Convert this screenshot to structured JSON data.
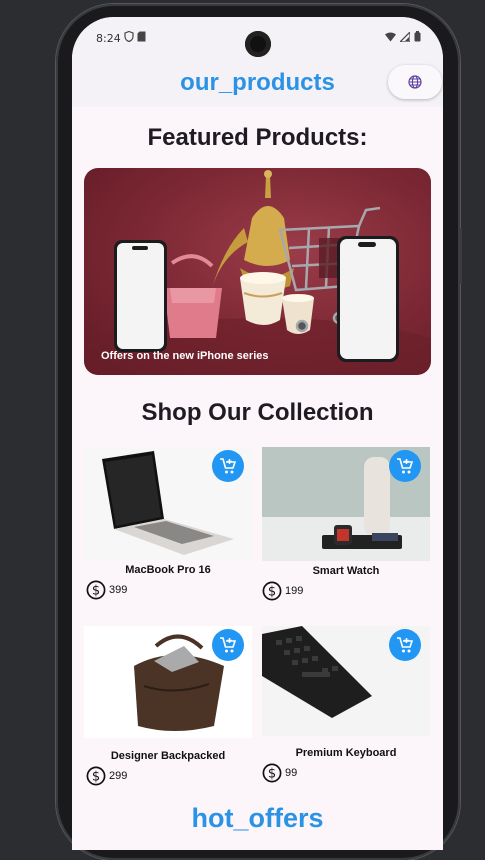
{
  "status_bar": {
    "time": "8:24"
  },
  "app_bar": {
    "title": "our_products",
    "language_icon": "globe-icon"
  },
  "featured": {
    "title": "Featured Products:",
    "banner_caption": "Offers on the new iPhone series"
  },
  "collection": {
    "title": "Shop Our Collection",
    "products": [
      {
        "name": "MacBook Pro 16",
        "price": "399",
        "cart_icon": "add-shopping-cart-icon"
      },
      {
        "name": "Smart Watch",
        "price": "199",
        "cart_icon": "add-shopping-cart-icon"
      },
      {
        "name": "Designer Backpacked",
        "price": "299",
        "cart_icon": "add-shopping-cart-icon"
      },
      {
        "name": "Premium Keyboard",
        "price": "99",
        "cart_icon": "add-shopping-cart-icon"
      }
    ]
  },
  "hot_offers": {
    "title": "hot_offers"
  },
  "colors": {
    "accent": "#2196f3",
    "title_blue": "#2a93e6",
    "background": "#fcf6fb"
  }
}
